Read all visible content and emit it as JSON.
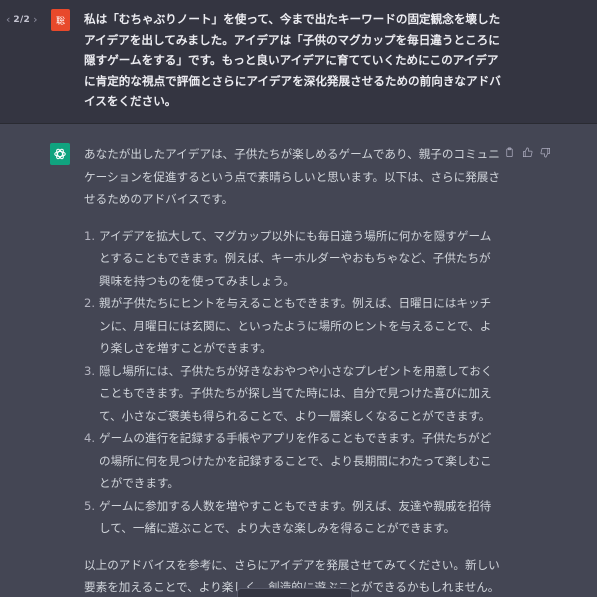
{
  "pager": {
    "prev": "‹",
    "count": "2/2",
    "next": "›"
  },
  "user": {
    "avatar_text": "聡",
    "message": "私は「むちゃぶりノート」を使って、今まで出たキーワードの固定観念を壊したアイデアを出してみました。アイデアは「子供のマグカップを毎日違うところに隠すゲームをする」です。もっと良いアイデアに育てていくためにこのアイデアに肯定的な視点で評価とさらにアイデアを深化発展させるための前向きなアドバイスをください。"
  },
  "assistant": {
    "intro": "あなたが出したアイデアは、子供たちが楽しめるゲームであり、親子のコミュニケーションを促進するという点で素晴らしいと思います。以下は、さらに発展させるためのアドバイスです。",
    "items": [
      {
        "num": "1.",
        "text": "アイデアを拡大して、マグカップ以外にも毎日違う場所に何かを隠すゲームとすることもできます。例えば、キーホルダーやおもちゃなど、子供たちが興味を持つものを使ってみましょう。"
      },
      {
        "num": "2.",
        "text": "親が子供たちにヒントを与えることもできます。例えば、日曜日にはキッチンに、月曜日には玄関に、といったように場所のヒントを与えることで、より楽しさを増すことができます。"
      },
      {
        "num": "3.",
        "text": "隠し場所には、子供たちが好きなおやつや小さなプレゼントを用意しておくこともできます。子供たちが探し当てた時には、自分で見つけた喜びに加えて、小さなご褒美も得られることで、より一層楽しくなることができます。"
      },
      {
        "num": "4.",
        "text": "ゲームの進行を記録する手帳やアプリを作ることもできます。子供たちがどの場所に何を見つけたかを記録することで、より長期間にわたって楽しむことができます。"
      },
      {
        "num": "5.",
        "text": "ゲームに参加する人数を増やすこともできます。例えば、友達や親戚を招待して、一緒に遊ぶことで、より大きな楽しみを得ることができます。"
      }
    ],
    "outro": "以上のアドバイスを参考に、さらにアイデアを発展させてみてください。新しい要素を加えることで、より楽しく、創造的に遊ぶことができるかもしれません。"
  },
  "icons": {
    "copy": "clipboard-icon",
    "like": "thumbs-up-icon",
    "dislike": "thumbs-down-icon"
  },
  "colors": {
    "user_bg": "#343541",
    "assistant_bg": "#444654",
    "user_avatar": "#e8492b",
    "assistant_avatar": "#10a37f"
  }
}
